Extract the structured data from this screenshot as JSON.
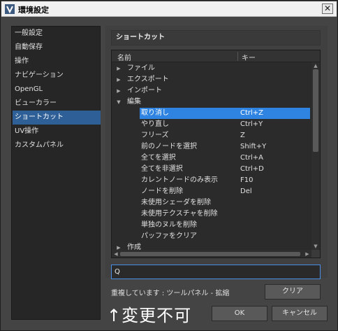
{
  "window": {
    "title": "環境設定",
    "close_icon": "close-icon"
  },
  "sidebar": {
    "items": [
      {
        "label": "一般設定"
      },
      {
        "label": "自動保存"
      },
      {
        "label": "操作"
      },
      {
        "label": "ナビゲーション"
      },
      {
        "label": "OpenGL"
      },
      {
        "label": "ビューカラー"
      },
      {
        "label": "ショートカット",
        "selected": true
      },
      {
        "label": "UV操作"
      },
      {
        "label": "カスタムパネル"
      }
    ]
  },
  "section_title": "ショートカット",
  "tree": {
    "columns": {
      "name": "名前",
      "key": "キー"
    },
    "rows": [
      {
        "name": "ファイル",
        "key": "",
        "level": 0,
        "arrow": "right"
      },
      {
        "name": "エクスポート",
        "key": "",
        "level": 0,
        "arrow": "right"
      },
      {
        "name": "インポート",
        "key": "",
        "level": 0,
        "arrow": "right"
      },
      {
        "name": "編集",
        "key": "",
        "level": 0,
        "arrow": "down"
      },
      {
        "name": "取り消し",
        "key": "Ctrl+Z",
        "level": 1,
        "selected": true
      },
      {
        "name": "やり直し",
        "key": "Ctrl+Y",
        "level": 1
      },
      {
        "name": "フリーズ",
        "key": "Z",
        "level": 1
      },
      {
        "name": "前のノードを選択",
        "key": "Shift+Y",
        "level": 1
      },
      {
        "name": "全てを選択",
        "key": "Ctrl+A",
        "level": 1
      },
      {
        "name": "全てを非選択",
        "key": "Ctrl+D",
        "level": 1
      },
      {
        "name": "カレントノードのみ表示",
        "key": "F10",
        "level": 1
      },
      {
        "name": "ノードを削除",
        "key": "Del",
        "level": 1
      },
      {
        "name": "未使用シェーダを削除",
        "key": "",
        "level": 1
      },
      {
        "name": "未使用テクスチャを削除",
        "key": "",
        "level": 1
      },
      {
        "name": "単独のヌルを削除",
        "key": "",
        "level": 1
      },
      {
        "name": "パッファをクリア",
        "key": "",
        "level": 1
      },
      {
        "name": "作成",
        "key": "",
        "level": 0,
        "arrow": "right"
      }
    ]
  },
  "search": {
    "value": "Q"
  },
  "conflict_text": "重複しています : ツールパネル - 拡縮",
  "buttons": {
    "clear": "クリア",
    "ok": "OK",
    "cancel": "キャンセル"
  },
  "annotation": "↑変更不可",
  "colors": {
    "selection": "#2f84e2",
    "sidebar_selection": "#2f5f97",
    "focus_border": "#4b8ee8"
  }
}
